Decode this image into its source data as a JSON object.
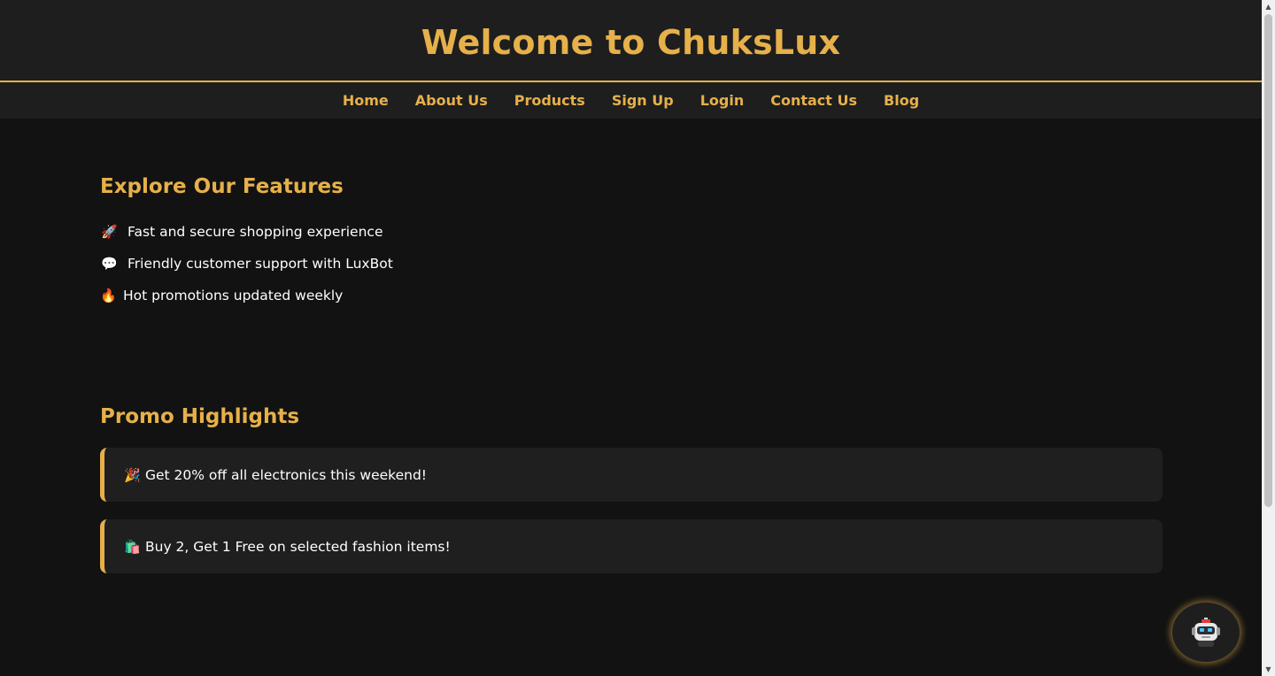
{
  "header": {
    "title": "Welcome to ChuksLux"
  },
  "nav": {
    "items": [
      {
        "label": "Home"
      },
      {
        "label": "About Us"
      },
      {
        "label": "Products"
      },
      {
        "label": "Sign Up"
      },
      {
        "label": "Login"
      },
      {
        "label": "Contact Us"
      },
      {
        "label": "Blog"
      }
    ]
  },
  "features": {
    "title": "Explore Our Features",
    "items": [
      {
        "icon": "🚀",
        "icon_name": "rocket-icon",
        "text": "Fast and secure shopping experience"
      },
      {
        "icon": "💬",
        "icon_name": "speech-bubble-icon",
        "text": "Friendly customer support with LuxBot"
      },
      {
        "icon": "🔥",
        "icon_name": "fire-icon",
        "text": "Hot promotions updated weekly"
      }
    ]
  },
  "promos": {
    "title": "Promo Highlights",
    "items": [
      {
        "icon": "🎉",
        "icon_name": "party-popper-icon",
        "text": "Get 20% off all electronics this weekend!"
      },
      {
        "icon": "🛍️",
        "icon_name": "shopping-bags-icon",
        "text": "Buy 2, Get 1 Free on selected fashion items!"
      }
    ]
  },
  "chatbot": {
    "icon_name": "robot-icon"
  },
  "colors": {
    "accent": "#e6b04a",
    "background": "#121212",
    "surface": "#1e1e1e",
    "text": "#ffffff"
  }
}
